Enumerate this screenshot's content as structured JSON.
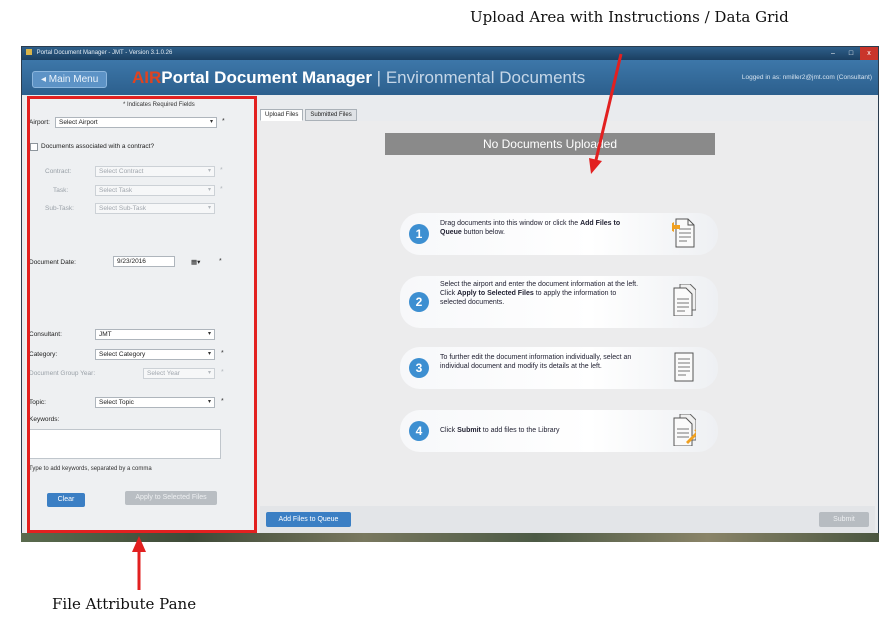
{
  "callouts": {
    "top": "Upload Area with Instructions / Data Grid",
    "bottom": "File Attribute Pane"
  },
  "window": {
    "title": "Portal Document Manager - JMT - Version 3.1.0.26",
    "controls": [
      "–",
      "□",
      "x"
    ]
  },
  "header": {
    "main_menu": "◂ Main Menu",
    "brand": "AIR",
    "title": "Portal Document Manager",
    "separator": "|",
    "subtitle": "Environmental Documents",
    "logged_in": "Logged in as: nmiller2@jmt.com (Consultant)"
  },
  "left_pane": {
    "required_note": "* Indicates Required Fields",
    "airport_label": "Airport:",
    "airport_value": "Select Airport",
    "contract_checkbox_label": "Documents associated with a contract?",
    "contract_label": "Contract:",
    "contract_value": "Select Contract",
    "task_label": "Task:",
    "task_value": "Select Task",
    "subtask_label": "Sub-Task:",
    "subtask_value": "Select Sub-Task",
    "date_label": "Document Date:",
    "date_value": "9/23/2016",
    "consultant_label": "Consultant:",
    "consultant_value": "JMT",
    "category_label": "Category:",
    "category_value": "Select Category",
    "group_year_label": "Document Group Year:",
    "group_year_value": "Select Year",
    "topic_label": "Topic:",
    "topic_value": "Select Topic",
    "keywords_label": "Keywords:",
    "keywords_hint": "Type to add keywords, separated by a comma",
    "clear_button": "Clear",
    "apply_button": "Apply to Selected Files",
    "required_star": "*",
    "caret": "▾",
    "calendar_icon": "▦▾"
  },
  "tabs": [
    "Upload Files",
    "Submitted Files"
  ],
  "upload": {
    "banner": "No Documents Uploaded",
    "steps": [
      {
        "num": "1",
        "text_a": "Drag documents into this window or click the ",
        "bold": "Add Files to Queue",
        "text_b": " button below."
      },
      {
        "num": "2",
        "text_a": "Select the airport and enter the document information at the left.  Click ",
        "bold": "Apply to Selected Files",
        "text_b": " to apply the information to selected documents."
      },
      {
        "num": "3",
        "text_a": "To further edit the document information individually, select an individual document and modify its details at the left.",
        "bold": "",
        "text_b": ""
      },
      {
        "num": "4",
        "text_a": "Click ",
        "bold": "Submit",
        "text_b": " to add files to the Library"
      }
    ]
  },
  "bottom_bar": {
    "add_files": "Add Files to Queue",
    "submit": "Submit"
  },
  "colors": {
    "header_blue": "#2c5f8d",
    "brand_red": "#e0431f",
    "callout_red": "#e22020",
    "button_blue": "#3b7fc4",
    "step_circle": "#3d8fd1"
  }
}
